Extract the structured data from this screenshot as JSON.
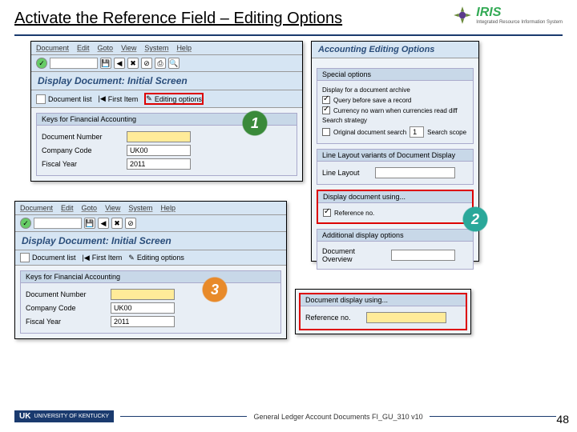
{
  "title": "Activate the Reference Field – Editing Options",
  "iris": {
    "brand": "IRIS",
    "sub": "Integrated Resource\nInformation System"
  },
  "win1": {
    "menu": [
      "Document",
      "Edit",
      "Goto",
      "View",
      "System",
      "Help"
    ],
    "screen_title": "Display Document: Initial Screen",
    "tabs": {
      "doclist": "Document list",
      "first": "First Item",
      "editing": "Editing options"
    },
    "group_label": "Keys for Financial Accounting",
    "fields": {
      "docnum_lbl": "Document Number",
      "docnum_val": "",
      "cocode_lbl": "Company Code",
      "cocode_val": "UK00",
      "fy_lbl": "Fiscal Year",
      "fy_val": "2011"
    }
  },
  "win2": {
    "menu": [
      "Document",
      "Edit",
      "Goto",
      "View",
      "System",
      "Help"
    ],
    "screen_title": "Display Document: Initial Screen",
    "tabs": {
      "doclist": "Document list",
      "first": "First Item",
      "editing": "Editing options"
    },
    "group_label": "Keys for Financial Accounting",
    "fields": {
      "docnum_lbl": "Document Number",
      "docnum_val": "",
      "cocode_lbl": "Company Code",
      "cocode_val": "UK00",
      "fy_lbl": "Fiscal Year",
      "fy_val": "2011"
    }
  },
  "win3": {
    "screen_title": "Accounting Editing Options",
    "group1_label": "Special options",
    "group1": {
      "disp_archive": "Display for a document archive",
      "query_save": "Query before save a record",
      "currency_warn": "Currency no warn when currencies read diff",
      "search_lbl": "Search strategy",
      "search1": "Original document search",
      "search_val": "1",
      "search2": "Search scope"
    },
    "group2_label": "Line Layout variants of Document Display",
    "group2_field": "Line Layout",
    "group3_label": "Display document using...",
    "ref_chk": "Reference no.",
    "group4_label": "Additional display options",
    "group4_field": "Document Overview"
  },
  "win4": {
    "group_label": "Document display using...",
    "ref_lbl": "Reference no.",
    "ref_val": ""
  },
  "badges": {
    "n1": "1",
    "n2": "2",
    "n3": "3"
  },
  "footer": {
    "uk": "UNIVERSITY OF KENTUCKY",
    "doc": "General Ledger Account Documents FI_GU_310 v10"
  },
  "page": "48"
}
